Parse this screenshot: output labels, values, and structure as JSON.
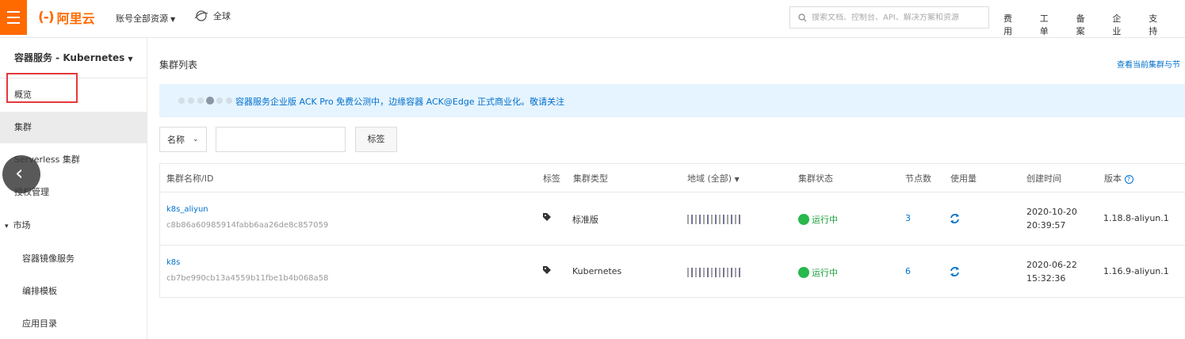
{
  "topbar": {
    "logo_mark": "(-)",
    "logo_text": "阿里云",
    "account_label": "账号全部资源",
    "region_label": "全球",
    "search_placeholder": "搜索文档、控制台、API、解决方案和资源",
    "links": [
      "费用",
      "工单",
      "备案",
      "企业",
      "支持"
    ]
  },
  "sidebar": {
    "title": "容器服务 - Kubernetes",
    "items": [
      {
        "label": "概览"
      },
      {
        "label": "集群"
      },
      {
        "label": "Serverless 集群"
      },
      {
        "label": "授权管理"
      },
      {
        "label": "市场"
      },
      {
        "label": "容器镜像服务"
      },
      {
        "label": "编排模板"
      },
      {
        "label": "应用目录"
      }
    ],
    "expand_marker": "▾",
    "back_arrow": "‹"
  },
  "main": {
    "title": "集群列表",
    "top_right_link": "查看当前集群与节",
    "notice_text": "容器服务企业版 ACK Pro 免费公测中，边缘容器 ACK@Edge 正式商业化。敬请关注",
    "filter": {
      "select_value": "名称",
      "tag_button": "标签"
    },
    "table": {
      "headers": [
        "集群名称/ID",
        "标签",
        "集群类型",
        "地域 (全部)",
        "集群状态",
        "节点数",
        "使用量",
        "创建时间",
        "版本"
      ],
      "rows": [
        {
          "name": "k8s_aliyun",
          "id": "c8b86a60985914fabb6aa26de8c857059",
          "type": "标准版",
          "status": "运行中",
          "nodes": "3",
          "date": "2020-10-20",
          "time": "20:39:57",
          "version": "1.18.8-aliyun.1"
        },
        {
          "name": "k8s",
          "id": "cb7be990cb13a4559b11fbe1b4b068a58",
          "type": "Kubernetes",
          "status": "运行中",
          "nodes": "6",
          "date": "2020-06-22",
          "time": "15:32:36",
          "version": "1.16.9-aliyun.1"
        }
      ]
    }
  },
  "colors": {
    "brand": "#ff6a00",
    "link": "#0070cc",
    "running": "#28b84b",
    "notice_bg": "#e6f4ff",
    "highlight": "#e5383b"
  }
}
